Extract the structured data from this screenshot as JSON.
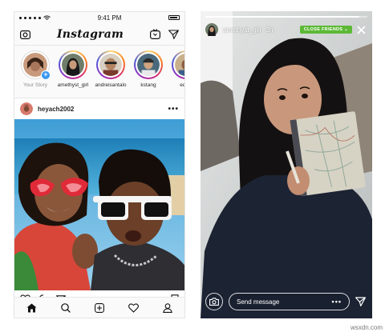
{
  "feed": {
    "status_bar": {
      "time": "9:41 PM"
    },
    "app_title": "Instagram",
    "stories": [
      {
        "label": "Your Story",
        "own": true
      },
      {
        "label": "amethyst_girl"
      },
      {
        "label": "andreisantalo"
      },
      {
        "label": "kstang"
      },
      {
        "label": "edsal"
      }
    ],
    "post": {
      "username": "heyach2002",
      "more": "•••"
    }
  },
  "story": {
    "username": "amethyst_girl",
    "time": "3h",
    "badge": "CLOSE FRIENDS",
    "badge_color": "#5cb936",
    "message_placeholder": "Send message",
    "more": "•••",
    "progress": 0.95
  },
  "watermark": "wsxdn.com",
  "icons": {
    "header_left": "camera-icon",
    "header_right": [
      "igtv-icon",
      "direct-icon"
    ],
    "post_actions": [
      "heart-icon",
      "comment-icon",
      "share-icon",
      "bookmark-icon"
    ],
    "nav": [
      "home-icon",
      "search-icon",
      "add-icon",
      "activity-icon",
      "profile-icon"
    ],
    "story": [
      "camera-icon",
      "close-icon",
      "send-icon"
    ]
  }
}
